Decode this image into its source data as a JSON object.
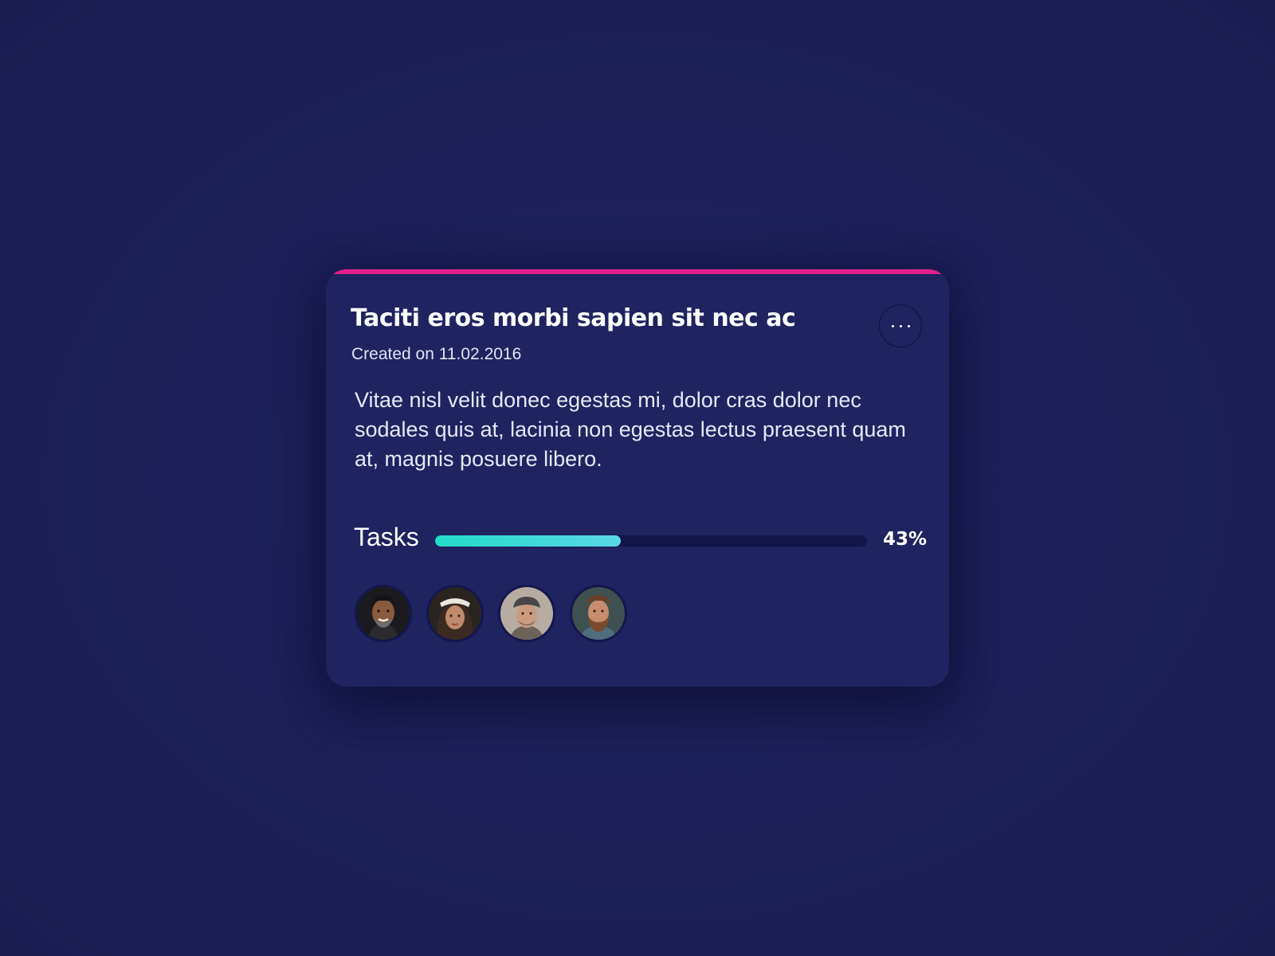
{
  "card": {
    "title": "Taciti eros morbi sapien sit nec ac",
    "created": "Created on 11.02.2016",
    "description": "Vitae nisl velit donec egestas mi, dolor cras dolor nec sodales quis at, lacinia non egestas lectus praesent quam at, magnis posuere libero.",
    "more_icon": "more-horizontal-icon",
    "accent_color": "#e5208e"
  },
  "tasks": {
    "label": "Tasks",
    "progress": 0.43,
    "progress_label": "43%",
    "fill_color_start": "#23dcc8",
    "fill_color_end": "#5ad7e8"
  },
  "members": [
    {
      "avatar": "avatar-photo"
    },
    {
      "avatar": "avatar-photo"
    },
    {
      "avatar": "avatar-photo"
    },
    {
      "avatar": "avatar-photo"
    }
  ]
}
